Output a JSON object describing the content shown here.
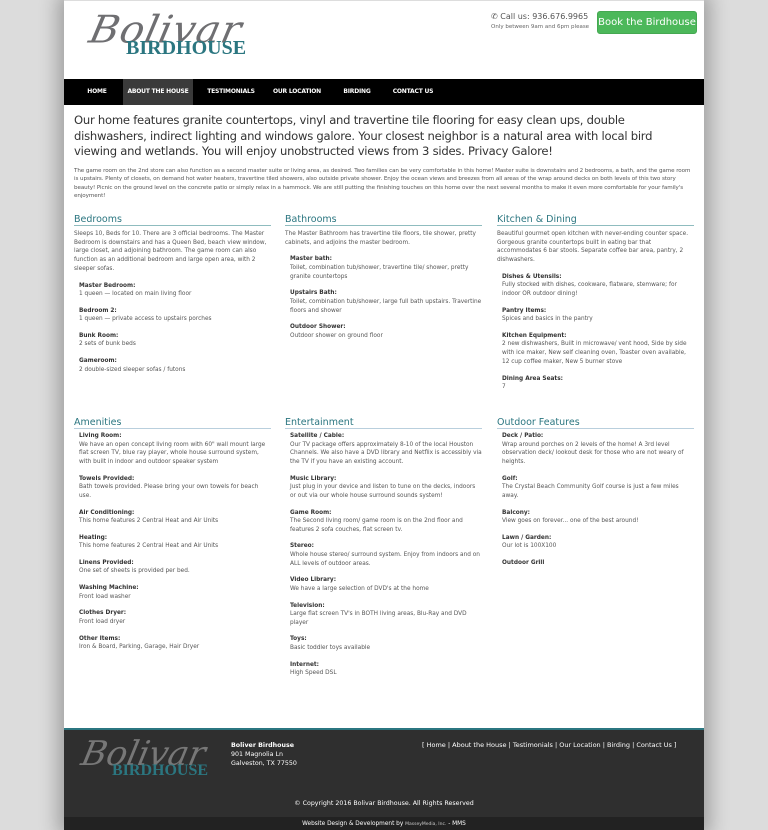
{
  "brand": {
    "script": "Bolivar",
    "word": "BIRDHOUSE"
  },
  "header": {
    "phone_icon": "phone-icon",
    "phone": "Call us: 936.676.9965",
    "hours_note": "Only between 9am and 6pm please",
    "book_label": "Book the Birdhouse",
    "book_color": "#4cb85a"
  },
  "nav": {
    "items": [
      {
        "label": "HOME",
        "active": false
      },
      {
        "label": "ABOUT THE HOUSE",
        "active": true
      },
      {
        "label": "TESTIMONIALS",
        "active": false
      },
      {
        "label": "OUR LOCATION",
        "active": false
      },
      {
        "label": "BIRDING",
        "active": false
      },
      {
        "label": "CONTACT US",
        "active": false
      }
    ]
  },
  "main": {
    "lead": "Our home features granite countertops, vinyl and travertine tile flooring for easy clean ups, double dishwashers, indirect lighting and windows galore. Your closest neighbor is a natural area with local bird viewing and wetlands. You will enjoy unobstructed views from 3 sides. Privacy Galore!",
    "intro": "The game room on the 2nd store can also function as a second master suite or living area, as desired. Two families can be very comfortable in this home! Master suite is downstairs and 2 bedrooms, a bath, and the game room is upstairs. Plenty of closets, on demand hot water heaters, travertine tiled showers, also outside private shower. Enjoy the ocean views and breezes from all areas of the wrap around decks on both levels of this two story beauty! Picnic on the ground level on the concrete patio or simply relax in a hammock. We are still putting the finishing touches on this home over the next several months to make it even more comfortable for your family's enjoyment!",
    "sections": [
      {
        "title": "Bedrooms",
        "desc": "Sleeps 10, Beds for 10. There are 3 official bedrooms. The Master Bedroom is downstairs and has a Queen Bed, beach view window, large closet, and adjoining bathroom. The game room can also function as an additional bedroom and large open area, with 2 sleeper sofas.",
        "items": [
          {
            "label": "Master Bedroom:",
            "value": "1 queen — located on main living floor"
          },
          {
            "label": "Bedroom 2:",
            "value": "1 queen — private access to upstairs porches"
          },
          {
            "label": "Bunk Room:",
            "value": "2 sets of bunk beds"
          },
          {
            "label": "Gameroom:",
            "value": "2 double-sized sleeper sofas / futons"
          }
        ]
      },
      {
        "title": "Bathrooms",
        "desc": "The Master Bathroom has travertine tile floors, tile shower, pretty cabinets, and adjoins the master bedroom.",
        "items": [
          {
            "label": "Master bath:",
            "value": "Toilet, combination tub/shower, travertine tile/ shower, pretty granite countertops"
          },
          {
            "label": "Upstairs Bath:",
            "value": "Toilet, combination tub/shower, large full bath upstairs. Travertine floors and shower"
          },
          {
            "label": "Outdoor Shower:",
            "value": "Outdoor shower on ground floor"
          }
        ]
      },
      {
        "title": "Kitchen & Dining",
        "desc": "Beautiful gourmet open kitchen with never-ending counter space. Gorgeous granite countertops built in eating bar that accommodates 6 bar stools. Separate coffee bar area, pantry, 2 dishwashers.",
        "items": [
          {
            "label": "Dishes & Utensils:",
            "value": "Fully stocked with dishes, cookware, flatware, stemware; for indoor OR outdoor dining!"
          },
          {
            "label": "Pantry Items:",
            "value": "Spices and basics in the pantry"
          },
          {
            "label": "Kitchen Equipment:",
            "value": "2 new dishwashers, Built in microwave/ vent hood, Side by side with ice maker, New self cleaning oven, Toaster oven available, 12 cup coffee maker, New 5 burner stove"
          },
          {
            "label": "Dining Area Seats:",
            "value": "7"
          }
        ]
      },
      {
        "title": "Amenities",
        "items": [
          {
            "label": "Living Room:",
            "value": "We have an open concept living room with 60\" wall mount large flat screen TV, blue ray player, whole house surround system, with built in indoor and outdoor speaker system"
          },
          {
            "label": "Towels Provided:",
            "value": "Bath towels provided. Please bring your own towels for beach use."
          },
          {
            "label": "Air Conditioning:",
            "value": "This home features 2 Central Heat and Air Units"
          },
          {
            "label": "Heating:",
            "value": "This home features 2 Central Heat and Air Units"
          },
          {
            "label": "Linens Provided:",
            "value": "One set of sheets is provided per bed."
          },
          {
            "label": "Washing Machine:",
            "value": "Front load washer"
          },
          {
            "label": "Clothes Dryer:",
            "value": "Front load dryer"
          },
          {
            "label": "Other Items:",
            "value": "Iron & Board, Parking, Garage, Hair Dryer"
          }
        ]
      },
      {
        "title": "Entertainment",
        "items": [
          {
            "label": "Satellite / Cable:",
            "value": "Our TV package offers approximately 8-10 of the local Houston Channels. We also have a DVD library and Netflix is accessibly via the TV if you have an existing account."
          },
          {
            "label": "Music Library:",
            "value": "Just plug in your device and listen to tune on the decks, indoors or out via our whole house surround sounds system!"
          },
          {
            "label": "Game Room:",
            "value": "The Second living room/ game room is on the 2nd floor and features 2 sofa couches, flat screen tv."
          },
          {
            "label": "Stereo:",
            "value": "Whole house stereo/ surround system. Enjoy from indoors and on ALL levels of outdoor areas."
          },
          {
            "label": "Video Library:",
            "value": "We have a large selection of DVD's at the home"
          },
          {
            "label": "Television:",
            "value": "Large flat screen TV's in BOTH living areas, Blu-Ray and DVD player"
          },
          {
            "label": "Toys:",
            "value": "Basic toddler toys available"
          },
          {
            "label": "Internet:",
            "value": "High Speed DSL"
          }
        ]
      },
      {
        "title": "Outdoor Features",
        "items": [
          {
            "label": "Deck / Patio:",
            "value": "Wrap around porches on 2 levels of the home! A 3rd level observation deck/ lookout desk for those who are not weary of heights."
          },
          {
            "label": "Golf:",
            "value": "The Crystal Beach Community Golf course is just a few miles away."
          },
          {
            "label": "Balcony:",
            "value": "View goes on forever... one of the best around!"
          },
          {
            "label": "Lawn / Garden:",
            "value": "Our lot is 100X100"
          },
          {
            "label": "Outdoor Grill",
            "value": ""
          }
        ]
      }
    ]
  },
  "footer": {
    "name": "Boliver Birdhouse",
    "street": "901 Magnolia Ln",
    "city": "Galveston, TX 77550",
    "links": [
      "Home",
      "About the House",
      "Testimonials",
      "Our Location",
      "Birding",
      "Contact Us"
    ],
    "copyright": "© Copyright 2016 Bolivar Birdhouse. All Rights Reserved",
    "credit_prefix": "Website Design & Development by",
    "credit_company": "MasseyMedia, Inc.",
    "credit_suffix": "- MMS"
  },
  "colors": {
    "accent": "#2b7680",
    "nav_bg": "#000000",
    "footer_bg": "#2f2f2f",
    "button": "#4cb85a"
  }
}
